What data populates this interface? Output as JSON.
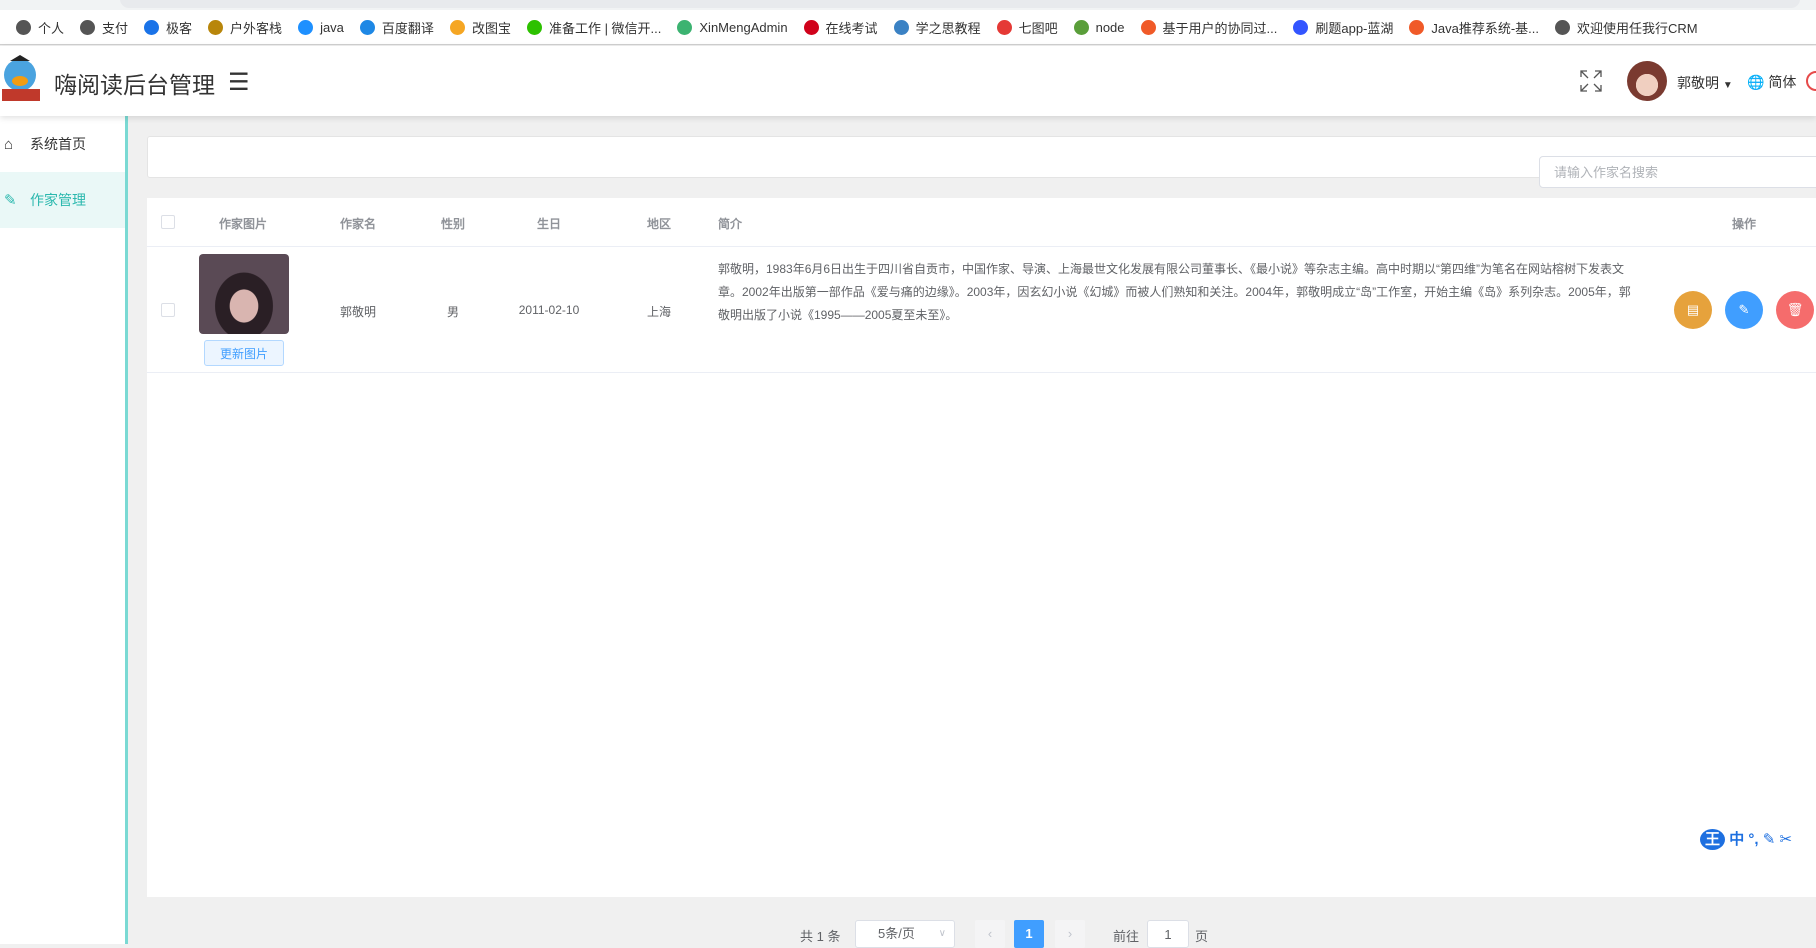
{
  "browser": {
    "bookmarks": [
      "个人",
      "支付",
      "极客",
      "户外客栈",
      "java",
      "百度翻译",
      "改图宝",
      "准备工作 | 微信开...",
      "XinMengAdmin",
      "在线考试",
      "学之思教程",
      "七图吧",
      "node",
      "基于用户的协同过...",
      "刷题app-蓝湖",
      "Java推荐系统-基...",
      "欢迎使用任我行CRM"
    ]
  },
  "header": {
    "title": "嗨阅读后台管理",
    "username": "郭敬明",
    "language": "简体"
  },
  "sidebar": {
    "items": [
      {
        "label": "系统首页",
        "icon": "home-icon"
      },
      {
        "label": "作家管理",
        "icon": "edit-icon",
        "active": true
      }
    ]
  },
  "search": {
    "placeholder": "请输入作家名搜索"
  },
  "table": {
    "columns": [
      "作家图片",
      "作家名",
      "性别",
      "生日",
      "地区",
      "简介",
      "操作"
    ],
    "rows": [
      {
        "update_label": "更新图片",
        "name": "郭敬明",
        "gender": "男",
        "birthday": "2011-02-10",
        "region": "上海",
        "intro": "郭敬明，1983年6月6日出生于四川省自贡市，中国作家、导演、上海最世文化发展有限公司董事长、《最小说》等杂志主编。高中时期以“第四维”为笔名在网站榕树下发表文章。2002年出版第一部作品《爱与痛的边缘》。2003年，因玄幻小说《幻城》而被人们熟知和关注。2004年，郭敬明成立“岛”工作室，开始主编《岛》系列杂志。2005年，郭敬明出版了小说《1995——2005夏至未至》。"
      }
    ]
  },
  "pagination": {
    "total": "共 1 条",
    "page_size": "5条/页",
    "current": "1",
    "goto_prefix": "前往",
    "goto_value": "1",
    "goto_suffix": "页"
  },
  "ime": {
    "label": "中"
  },
  "colors": {
    "accent": "#2bb8ae",
    "primary": "#409eff",
    "warning": "#e6a23c",
    "danger": "#f56c6c"
  }
}
